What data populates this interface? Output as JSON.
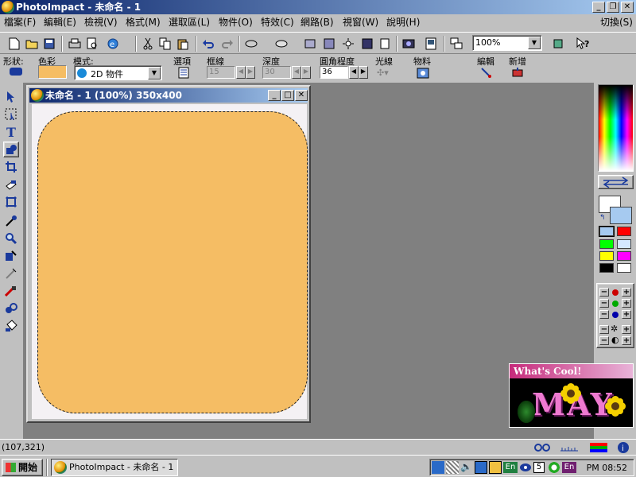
{
  "app": {
    "title": "PhotoImpact - 未命名 - 1",
    "switch_label": "切換(S)"
  },
  "menu": [
    "檔案(F)",
    "編輯(E)",
    "檢視(V)",
    "格式(M)",
    "選取區(L)",
    "物件(O)",
    "特效(C)",
    "網路(B)",
    "視窗(W)",
    "說明(H)"
  ],
  "toolbar": {
    "zoom_value": "100%"
  },
  "attr": {
    "shape_label": "形狀:",
    "color_label": "色彩",
    "mode_label": "模式:",
    "mode_value": "2D 物件",
    "options_label": "選項",
    "border_label": "框線",
    "border_value": "15",
    "depth_label": "深度",
    "depth_value": "30",
    "radius_label": "圓角程度",
    "radius_value": "36",
    "light_label": "光線",
    "material_label": "物料",
    "edit_label": "編輯",
    "add_label": "新增",
    "fill_color": "#f5bd64"
  },
  "document": {
    "title": "未命名 - 1 (100%) 350x400"
  },
  "cool": {
    "header": "What's Cool!",
    "text": "MAY"
  },
  "status": {
    "coords": "(107,321)"
  },
  "taskbar": {
    "start": "開始",
    "task_item": "PhotoImpact - 未命名 - 1",
    "clock": "PM 08:52",
    "tray_lang": "En",
    "tray_num": "5"
  },
  "palette": {
    "swatches": [
      "#a6caf0",
      "#ff0000",
      "#00ff00",
      "#ffffff",
      "#ffff00",
      "#ff00ff",
      "#000000",
      "#ffffff"
    ]
  }
}
